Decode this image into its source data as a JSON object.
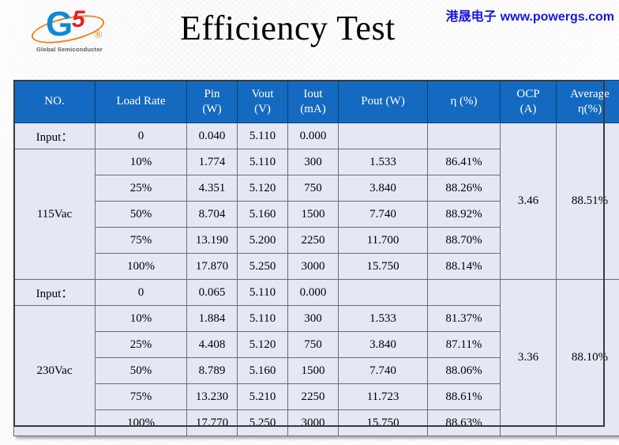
{
  "slide": {
    "title": "Efficiency Test",
    "watermark_cn": "港晟电子",
    "watermark_url": "www.powergs.com",
    "accent_header_color": "#1469c0",
    "cell_color": "#e3e8f4",
    "watermark_color": "#1715e0"
  },
  "logo": {
    "letter": "G",
    "digit": "5",
    "registered": "®",
    "caption": "Global Semiconductor",
    "blue": "#0b8ad8",
    "red": "#ed1c24",
    "orange": "#f08020"
  },
  "table": {
    "headers": {
      "no": "NO.",
      "load_rate": "Load Rate",
      "pin": "Pin",
      "pin_unit": "(W)",
      "vout": "Vout",
      "vout_unit": "(V)",
      "iout": "Iout",
      "iout_unit": "(mA)",
      "pout": "Pout  (W)",
      "eta": "η (%)",
      "ocp": "OCP",
      "ocp_unit": "(A)",
      "average": "Average",
      "average_unit": "η(%)"
    },
    "groups": [
      {
        "input_label": "Input：",
        "name": "115Vac",
        "ocp": "3.46",
        "average": "88.51%",
        "idle": {
          "load_rate": "0",
          "pin": "0.040",
          "vout": "5.110",
          "iout": "0.000",
          "pout": "",
          "eta": ""
        },
        "rows": [
          {
            "load_rate": "10%",
            "pin": "1.774",
            "vout": "5.110",
            "iout": "300",
            "pout": "1.533",
            "eta": "86.41%"
          },
          {
            "load_rate": "25%",
            "pin": "4.351",
            "vout": "5.120",
            "iout": "750",
            "pout": "3.840",
            "eta": "88.26%"
          },
          {
            "load_rate": "50%",
            "pin": "8.704",
            "vout": "5.160",
            "iout": "1500",
            "pout": "7.740",
            "eta": "88.92%"
          },
          {
            "load_rate": "75%",
            "pin": "13.190",
            "vout": "5.200",
            "iout": "2250",
            "pout": "11.700",
            "eta": "88.70%"
          },
          {
            "load_rate": "100%",
            "pin": "17.870",
            "vout": "5.250",
            "iout": "3000",
            "pout": "15.750",
            "eta": "88.14%"
          }
        ]
      },
      {
        "input_label": "Input：",
        "name": "230Vac",
        "ocp": "3.36",
        "average": "88.10%",
        "idle": {
          "load_rate": "0",
          "pin": "0.065",
          "vout": "5.110",
          "iout": "0.000",
          "pout": "",
          "eta": ""
        },
        "rows": [
          {
            "load_rate": "10%",
            "pin": "1.884",
            "vout": "5.110",
            "iout": "300",
            "pout": "1.533",
            "eta": "81.37%"
          },
          {
            "load_rate": "25%",
            "pin": "4.408",
            "vout": "5.120",
            "iout": "750",
            "pout": "3.840",
            "eta": "87.11%"
          },
          {
            "load_rate": "50%",
            "pin": "8.789",
            "vout": "5.160",
            "iout": "1500",
            "pout": "7.740",
            "eta": "88.06%"
          },
          {
            "load_rate": "75%",
            "pin": "13.230",
            "vout": "5.210",
            "iout": "2250",
            "pout": "11.723",
            "eta": "88.61%"
          },
          {
            "load_rate": "100%",
            "pin": "17.770",
            "vout": "5.250",
            "iout": "3000",
            "pout": "15.750",
            "eta": "88.63%"
          }
        ]
      }
    ]
  },
  "chart_data": {
    "type": "table",
    "title": "Efficiency Test",
    "columns": [
      "NO.",
      "Load Rate",
      "Pin (W)",
      "Vout (V)",
      "Iout (mA)",
      "Pout (W)",
      "η (%)",
      "OCP (A)",
      "Average η(%)"
    ],
    "rows": [
      [
        "Input：",
        "0",
        "0.040",
        "5.110",
        "0.000",
        "",
        "",
        "",
        ""
      ],
      [
        "115Vac",
        "10%",
        "1.774",
        "5.110",
        "300",
        "1.533",
        "86.41%",
        "3.46",
        "88.51%"
      ],
      [
        "115Vac",
        "25%",
        "4.351",
        "5.120",
        "750",
        "3.840",
        "88.26%",
        "3.46",
        "88.51%"
      ],
      [
        "115Vac",
        "50%",
        "8.704",
        "5.160",
        "1500",
        "7.740",
        "88.92%",
        "3.46",
        "88.51%"
      ],
      [
        "115Vac",
        "75%",
        "13.190",
        "5.200",
        "2250",
        "11.700",
        "88.70%",
        "3.46",
        "88.51%"
      ],
      [
        "115Vac",
        "100%",
        "17.870",
        "5.250",
        "3000",
        "15.750",
        "88.14%",
        "3.46",
        "88.51%"
      ],
      [
        "Input：",
        "0",
        "0.065",
        "5.110",
        "0.000",
        "",
        "",
        "",
        ""
      ],
      [
        "230Vac",
        "10%",
        "1.884",
        "5.110",
        "300",
        "1.533",
        "81.37%",
        "3.36",
        "88.10%"
      ],
      [
        "230Vac",
        "25%",
        "4.408",
        "5.120",
        "750",
        "3.840",
        "87.11%",
        "3.36",
        "88.10%"
      ],
      [
        "230Vac",
        "50%",
        "8.789",
        "5.160",
        "1500",
        "7.740",
        "88.06%",
        "3.36",
        "88.10%"
      ],
      [
        "230Vac",
        "75%",
        "13.230",
        "5.210",
        "2250",
        "11.723",
        "88.61%",
        "3.36",
        "88.10%"
      ],
      [
        "230Vac",
        "100%",
        "17.770",
        "5.250",
        "3000",
        "15.750",
        "88.63%",
        "3.36",
        "88.10%"
      ]
    ]
  }
}
